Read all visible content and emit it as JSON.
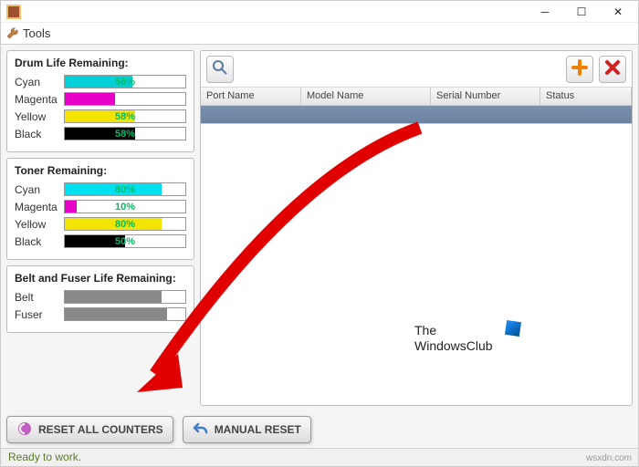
{
  "window": {
    "menu_tools": "Tools"
  },
  "panels": {
    "drum": {
      "title": "Drum Life Remaining:",
      "items": [
        {
          "label": "Cyan",
          "pct": 56,
          "color": "#00d0d8",
          "text": "56%"
        },
        {
          "label": "Magenta",
          "pct": 42,
          "color": "#e600c8",
          "text": ""
        },
        {
          "label": "Yellow",
          "pct": 58,
          "color": "#f2e400",
          "text": "58%"
        },
        {
          "label": "Black",
          "pct": 58,
          "color": "#000000",
          "text": "58%"
        }
      ]
    },
    "toner": {
      "title": "Toner Remaining:",
      "items": [
        {
          "label": "Cyan",
          "pct": 80,
          "color": "#00e0f0",
          "text": "80%"
        },
        {
          "label": "Magenta",
          "pct": 10,
          "color": "#e600c8",
          "text": "10%"
        },
        {
          "label": "Yellow",
          "pct": 80,
          "color": "#f2e400",
          "text": "80%"
        },
        {
          "label": "Black",
          "pct": 50,
          "color": "#000000",
          "text": "50%"
        }
      ]
    },
    "belt": {
      "title": "Belt and Fuser Life Remaining:",
      "items": [
        {
          "label": "Belt",
          "pct": 80,
          "color": "#888888",
          "text": ""
        },
        {
          "label": "Fuser",
          "pct": 85,
          "color": "#888888",
          "text": ""
        }
      ]
    }
  },
  "table": {
    "headers": [
      "Port Name",
      "Model Name",
      "Serial Number",
      "Status"
    ]
  },
  "buttons": {
    "reset_all": "RESET ALL COUNTERS",
    "manual_reset": "MANUAL RESET"
  },
  "status": "Ready to work.",
  "watermark": "wsxdn.com",
  "overlay_text": {
    "line1": "The",
    "line2": "WindowsClub"
  }
}
